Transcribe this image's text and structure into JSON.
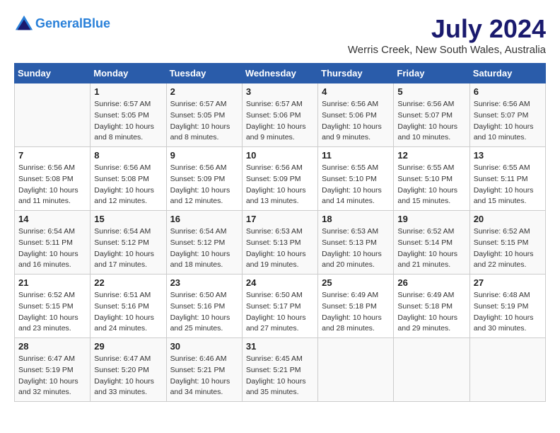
{
  "header": {
    "logo_line1": "General",
    "logo_line2": "Blue",
    "month_title": "July 2024",
    "location": "Werris Creek, New South Wales, Australia"
  },
  "days_of_week": [
    "Sunday",
    "Monday",
    "Tuesday",
    "Wednesday",
    "Thursday",
    "Friday",
    "Saturday"
  ],
  "weeks": [
    [
      {
        "day": "",
        "sunrise": "",
        "sunset": "",
        "daylight": ""
      },
      {
        "day": "1",
        "sunrise": "Sunrise: 6:57 AM",
        "sunset": "Sunset: 5:05 PM",
        "daylight": "Daylight: 10 hours and 8 minutes."
      },
      {
        "day": "2",
        "sunrise": "Sunrise: 6:57 AM",
        "sunset": "Sunset: 5:05 PM",
        "daylight": "Daylight: 10 hours and 8 minutes."
      },
      {
        "day": "3",
        "sunrise": "Sunrise: 6:57 AM",
        "sunset": "Sunset: 5:06 PM",
        "daylight": "Daylight: 10 hours and 9 minutes."
      },
      {
        "day": "4",
        "sunrise": "Sunrise: 6:56 AM",
        "sunset": "Sunset: 5:06 PM",
        "daylight": "Daylight: 10 hours and 9 minutes."
      },
      {
        "day": "5",
        "sunrise": "Sunrise: 6:56 AM",
        "sunset": "Sunset: 5:07 PM",
        "daylight": "Daylight: 10 hours and 10 minutes."
      },
      {
        "day": "6",
        "sunrise": "Sunrise: 6:56 AM",
        "sunset": "Sunset: 5:07 PM",
        "daylight": "Daylight: 10 hours and 10 minutes."
      }
    ],
    [
      {
        "day": "7",
        "sunrise": "Sunrise: 6:56 AM",
        "sunset": "Sunset: 5:08 PM",
        "daylight": "Daylight: 10 hours and 11 minutes."
      },
      {
        "day": "8",
        "sunrise": "Sunrise: 6:56 AM",
        "sunset": "Sunset: 5:08 PM",
        "daylight": "Daylight: 10 hours and 12 minutes."
      },
      {
        "day": "9",
        "sunrise": "Sunrise: 6:56 AM",
        "sunset": "Sunset: 5:09 PM",
        "daylight": "Daylight: 10 hours and 12 minutes."
      },
      {
        "day": "10",
        "sunrise": "Sunrise: 6:56 AM",
        "sunset": "Sunset: 5:09 PM",
        "daylight": "Daylight: 10 hours and 13 minutes."
      },
      {
        "day": "11",
        "sunrise": "Sunrise: 6:55 AM",
        "sunset": "Sunset: 5:10 PM",
        "daylight": "Daylight: 10 hours and 14 minutes."
      },
      {
        "day": "12",
        "sunrise": "Sunrise: 6:55 AM",
        "sunset": "Sunset: 5:10 PM",
        "daylight": "Daylight: 10 hours and 15 minutes."
      },
      {
        "day": "13",
        "sunrise": "Sunrise: 6:55 AM",
        "sunset": "Sunset: 5:11 PM",
        "daylight": "Daylight: 10 hours and 15 minutes."
      }
    ],
    [
      {
        "day": "14",
        "sunrise": "Sunrise: 6:54 AM",
        "sunset": "Sunset: 5:11 PM",
        "daylight": "Daylight: 10 hours and 16 minutes."
      },
      {
        "day": "15",
        "sunrise": "Sunrise: 6:54 AM",
        "sunset": "Sunset: 5:12 PM",
        "daylight": "Daylight: 10 hours and 17 minutes."
      },
      {
        "day": "16",
        "sunrise": "Sunrise: 6:54 AM",
        "sunset": "Sunset: 5:12 PM",
        "daylight": "Daylight: 10 hours and 18 minutes."
      },
      {
        "day": "17",
        "sunrise": "Sunrise: 6:53 AM",
        "sunset": "Sunset: 5:13 PM",
        "daylight": "Daylight: 10 hours and 19 minutes."
      },
      {
        "day": "18",
        "sunrise": "Sunrise: 6:53 AM",
        "sunset": "Sunset: 5:13 PM",
        "daylight": "Daylight: 10 hours and 20 minutes."
      },
      {
        "day": "19",
        "sunrise": "Sunrise: 6:52 AM",
        "sunset": "Sunset: 5:14 PM",
        "daylight": "Daylight: 10 hours and 21 minutes."
      },
      {
        "day": "20",
        "sunrise": "Sunrise: 6:52 AM",
        "sunset": "Sunset: 5:15 PM",
        "daylight": "Daylight: 10 hours and 22 minutes."
      }
    ],
    [
      {
        "day": "21",
        "sunrise": "Sunrise: 6:52 AM",
        "sunset": "Sunset: 5:15 PM",
        "daylight": "Daylight: 10 hours and 23 minutes."
      },
      {
        "day": "22",
        "sunrise": "Sunrise: 6:51 AM",
        "sunset": "Sunset: 5:16 PM",
        "daylight": "Daylight: 10 hours and 24 minutes."
      },
      {
        "day": "23",
        "sunrise": "Sunrise: 6:50 AM",
        "sunset": "Sunset: 5:16 PM",
        "daylight": "Daylight: 10 hours and 25 minutes."
      },
      {
        "day": "24",
        "sunrise": "Sunrise: 6:50 AM",
        "sunset": "Sunset: 5:17 PM",
        "daylight": "Daylight: 10 hours and 27 minutes."
      },
      {
        "day": "25",
        "sunrise": "Sunrise: 6:49 AM",
        "sunset": "Sunset: 5:18 PM",
        "daylight": "Daylight: 10 hours and 28 minutes."
      },
      {
        "day": "26",
        "sunrise": "Sunrise: 6:49 AM",
        "sunset": "Sunset: 5:18 PM",
        "daylight": "Daylight: 10 hours and 29 minutes."
      },
      {
        "day": "27",
        "sunrise": "Sunrise: 6:48 AM",
        "sunset": "Sunset: 5:19 PM",
        "daylight": "Daylight: 10 hours and 30 minutes."
      }
    ],
    [
      {
        "day": "28",
        "sunrise": "Sunrise: 6:47 AM",
        "sunset": "Sunset: 5:19 PM",
        "daylight": "Daylight: 10 hours and 32 minutes."
      },
      {
        "day": "29",
        "sunrise": "Sunrise: 6:47 AM",
        "sunset": "Sunset: 5:20 PM",
        "daylight": "Daylight: 10 hours and 33 minutes."
      },
      {
        "day": "30",
        "sunrise": "Sunrise: 6:46 AM",
        "sunset": "Sunset: 5:21 PM",
        "daylight": "Daylight: 10 hours and 34 minutes."
      },
      {
        "day": "31",
        "sunrise": "Sunrise: 6:45 AM",
        "sunset": "Sunset: 5:21 PM",
        "daylight": "Daylight: 10 hours and 35 minutes."
      },
      {
        "day": "",
        "sunrise": "",
        "sunset": "",
        "daylight": ""
      },
      {
        "day": "",
        "sunrise": "",
        "sunset": "",
        "daylight": ""
      },
      {
        "day": "",
        "sunrise": "",
        "sunset": "",
        "daylight": ""
      }
    ]
  ]
}
